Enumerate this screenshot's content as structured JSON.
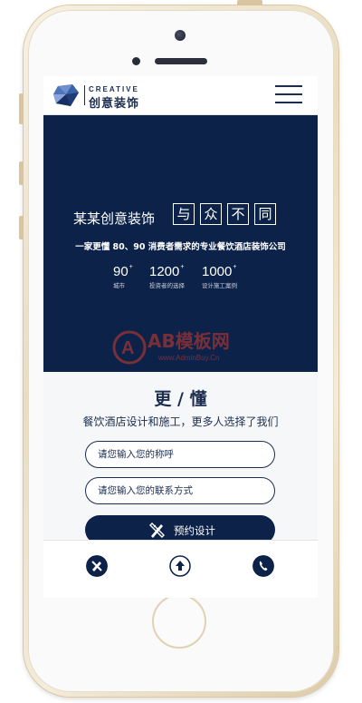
{
  "brand": {
    "en": "CREATIVE",
    "cn": "创意装饰"
  },
  "hero": {
    "title_prefix": "某某创意装饰",
    "title_boxes": [
      "与",
      "众",
      "不",
      "同"
    ],
    "subtitle": "一家更懂 80、90 消费者需求的专业餐饮酒店装饰公司",
    "stats": [
      {
        "value": "90",
        "sup": "+",
        "label": "城市"
      },
      {
        "value": "1200",
        "sup": "+",
        "label": "投资者的选择"
      },
      {
        "value": "1000",
        "sup": "+",
        "label": "设计施工案例"
      }
    ]
  },
  "form": {
    "title": "更 / 懂",
    "subtitle": "餐饮酒店设计和施工，更多人选择了我们",
    "name_placeholder": "请您输入您的称呼",
    "contact_placeholder": "请您输入您的联系方式",
    "submit_label": "预约设计"
  },
  "watermark": {
    "text": "AB模板网",
    "url": "www.AdminBuy.Cn"
  },
  "bottom_nav": [
    "tools-icon",
    "arrow-up-icon",
    "phone-icon"
  ],
  "colors": {
    "primary": "#0d2249",
    "text": "#1c2d4f",
    "accent_watermark": "#d23a2a"
  }
}
